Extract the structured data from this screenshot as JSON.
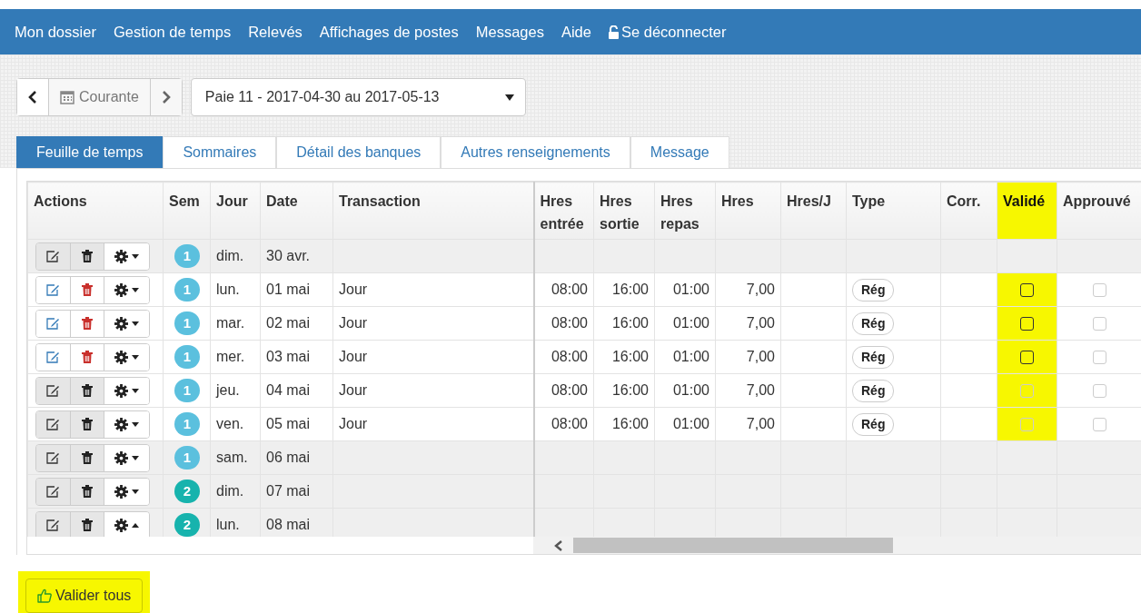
{
  "navbar": {
    "items": [
      {
        "label": "Mon dossier",
        "kind": "link"
      },
      {
        "label": "Gestion de temps",
        "kind": "link"
      },
      {
        "label": "Relevés",
        "kind": "link"
      },
      {
        "label": "Affichages de postes",
        "kind": "link"
      },
      {
        "label": "Messages",
        "kind": "link"
      },
      {
        "label": "Aide",
        "kind": "link"
      },
      {
        "label": "Se déconnecter",
        "kind": "logout"
      }
    ]
  },
  "period": {
    "current_label": "Courante",
    "select_value": "Paie 11 - 2017-04-30 au 2017-05-13"
  },
  "tabs": [
    {
      "label": "Feuille de temps",
      "selected": true
    },
    {
      "label": "Sommaires",
      "selected": false
    },
    {
      "label": "Détail des banques",
      "selected": false
    },
    {
      "label": "Autres renseignements",
      "selected": false
    },
    {
      "label": "Message",
      "selected": false
    }
  ],
  "table": {
    "columns": [
      {
        "label": "Actions",
        "highlighted": false
      },
      {
        "label": "Sem",
        "highlighted": false
      },
      {
        "label": "Jour",
        "highlighted": false
      },
      {
        "label": "Date",
        "highlighted": false
      },
      {
        "label": "Transaction",
        "highlighted": false
      },
      {
        "label": "Hres entrée",
        "highlighted": false
      },
      {
        "label": "Hres sortie",
        "highlighted": false
      },
      {
        "label": "Hres repas",
        "highlighted": false
      },
      {
        "label": "Hres",
        "highlighted": false
      },
      {
        "label": "Hres/J",
        "highlighted": false
      },
      {
        "label": "Type",
        "highlighted": false
      },
      {
        "label": "Corr.",
        "highlighted": false
      },
      {
        "label": "Validé",
        "highlighted": true
      },
      {
        "label": "Approuvé",
        "highlighted": false
      }
    ],
    "rows": [
      {
        "sem": {
          "text": "1",
          "color": "#5bc0de"
        },
        "jour": "dim.",
        "date": "30 avr.",
        "weekend": true,
        "editable": false,
        "dropdown_open": false
      },
      {
        "sem": {
          "text": "1",
          "color": "#5bc0de"
        },
        "jour": "lun.",
        "date": "01 mai",
        "transaction": "Jour",
        "entree": "08:00",
        "sortie": "16:00",
        "repas": "01:00",
        "hres": "7,00",
        "type": "Rég",
        "valide": {
          "checked": false,
          "disabled": false
        },
        "approuve": {
          "checked": false,
          "disabled": true
        },
        "weekend": false,
        "editable": true,
        "dropdown_open": false
      },
      {
        "sem": {
          "text": "1",
          "color": "#5bc0de"
        },
        "jour": "mar.",
        "date": "02 mai",
        "transaction": "Jour",
        "entree": "08:00",
        "sortie": "16:00",
        "repas": "01:00",
        "hres": "7,00",
        "type": "Rég",
        "valide": {
          "checked": false,
          "disabled": false
        },
        "approuve": {
          "checked": false,
          "disabled": true
        },
        "weekend": false,
        "editable": true,
        "dropdown_open": false
      },
      {
        "sem": {
          "text": "1",
          "color": "#5bc0de"
        },
        "jour": "mer.",
        "date": "03 mai",
        "transaction": "Jour",
        "entree": "08:00",
        "sortie": "16:00",
        "repas": "01:00",
        "hres": "7,00",
        "type": "Rég",
        "valide": {
          "checked": false,
          "disabled": false
        },
        "approuve": {
          "checked": false,
          "disabled": true
        },
        "weekend": false,
        "editable": true,
        "dropdown_open": false
      },
      {
        "sem": {
          "text": "1",
          "color": "#5bc0de"
        },
        "jour": "jeu.",
        "date": "04 mai",
        "transaction": "Jour",
        "entree": "08:00",
        "sortie": "16:00",
        "repas": "01:00",
        "hres": "7,00",
        "type": "Rég",
        "valide": {
          "checked": false,
          "disabled": true
        },
        "approuve": {
          "checked": false,
          "disabled": true
        },
        "weekend": false,
        "editable": false,
        "dropdown_open": false
      },
      {
        "sem": {
          "text": "1",
          "color": "#5bc0de"
        },
        "jour": "ven.",
        "date": "05 mai",
        "transaction": "Jour",
        "entree": "08:00",
        "sortie": "16:00",
        "repas": "01:00",
        "hres": "7,00",
        "type": "Rég",
        "valide": {
          "checked": false,
          "disabled": true
        },
        "approuve": {
          "checked": false,
          "disabled": true
        },
        "weekend": false,
        "editable": false,
        "dropdown_open": false
      },
      {
        "sem": {
          "text": "1",
          "color": "#5bc0de"
        },
        "jour": "sam.",
        "date": "06 mai",
        "weekend": true,
        "editable": false,
        "dropdown_open": false
      },
      {
        "sem": {
          "text": "2",
          "color": "#17b3ad"
        },
        "jour": "dim.",
        "date": "07 mai",
        "weekend": true,
        "editable": false,
        "dropdown_open": false
      },
      {
        "sem": {
          "text": "2",
          "color": "#17b3ad"
        },
        "jour": "lun.",
        "date": "08 mai",
        "weekend": true,
        "editable": false,
        "dropdown_open": true
      }
    ]
  },
  "validate_all": {
    "label": "Valider tous",
    "highlighted": true
  }
}
